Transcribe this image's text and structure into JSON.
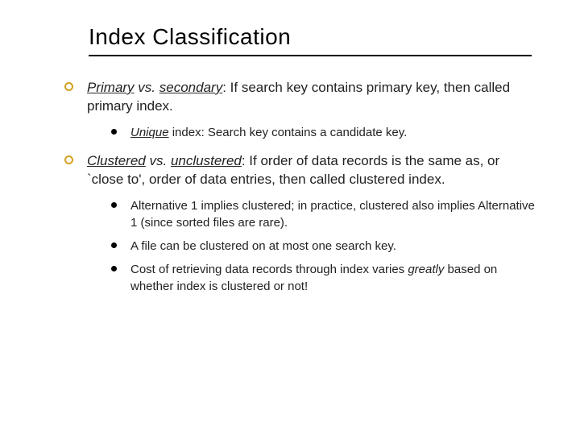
{
  "title": "Index Classification",
  "bullets": [
    {
      "html": "<span class='term'>Primary</span> <span class='ital'>vs.</span> <span class='term'>secondary</span>:  If search key contains primary key, then called primary index.",
      "sub": [
        {
          "html": "<span class='term'>Unique</span> index:  Search key contains a candidate key."
        }
      ]
    },
    {
      "html": "<span class='term'>Clustered</span> <span class='ital'>vs.</span> <span class='term'>unclustered</span>:  If order of data records is the same as, or `close to', order of data entries, then called clustered index.",
      "sub": [
        {
          "html": "Alternative 1 implies clustered; in practice, clustered also implies Alternative 1 (since sorted files are rare)."
        },
        {
          "html": "A file can be clustered on at most one search key."
        },
        {
          "html": "Cost of retrieving data records through index varies <span class='ital'>greatly</span> based on whether index is clustered or not!"
        }
      ]
    }
  ]
}
